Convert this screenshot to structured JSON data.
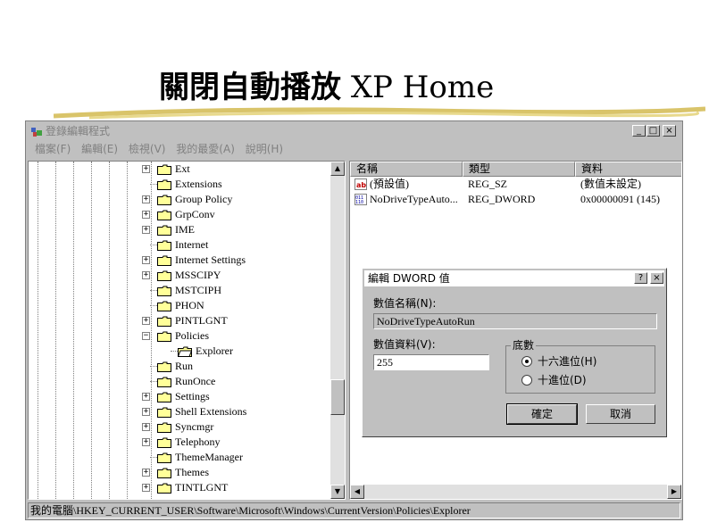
{
  "slide": {
    "title_cjk": "關閉自動播放",
    "title_latin": "XP Home"
  },
  "window": {
    "title": "登錄編輯程式",
    "buttons": {
      "minimize": "_",
      "maximize": "□",
      "close": "×"
    },
    "menu": [
      "檔案(F)",
      "編輯(E)",
      "檢視(V)",
      "我的最愛(A)",
      "說明(H)"
    ]
  },
  "tree": {
    "items": [
      {
        "label": "Ext",
        "expander": "+"
      },
      {
        "label": "Extensions",
        "expander": ""
      },
      {
        "label": "Group Policy",
        "expander": "+"
      },
      {
        "label": "GrpConv",
        "expander": "+"
      },
      {
        "label": "IME",
        "expander": "+"
      },
      {
        "label": "Internet",
        "expander": ""
      },
      {
        "label": "Internet Settings",
        "expander": "+"
      },
      {
        "label": "MSSCIPY",
        "expander": "+"
      },
      {
        "label": "MSTCIPH",
        "expander": ""
      },
      {
        "label": "PHON",
        "expander": ""
      },
      {
        "label": "PINTLGNT",
        "expander": "+"
      },
      {
        "label": "Policies",
        "expander": "−"
      },
      {
        "label": "Explorer",
        "expander": "",
        "child": true
      },
      {
        "label": "Run",
        "expander": ""
      },
      {
        "label": "RunOnce",
        "expander": ""
      },
      {
        "label": "Settings",
        "expander": "+"
      },
      {
        "label": "Shell Extensions",
        "expander": "+"
      },
      {
        "label": "Syncmgr",
        "expander": "+"
      },
      {
        "label": "Telephony",
        "expander": "+"
      },
      {
        "label": "ThemeManager",
        "expander": ""
      },
      {
        "label": "Themes",
        "expander": "+"
      },
      {
        "label": "TINTLGNT",
        "expander": "+"
      }
    ]
  },
  "list": {
    "headers": {
      "name": "名稱",
      "type": "類型",
      "data": "資料"
    },
    "rows": [
      {
        "name": "(預設值)",
        "type": "REG_SZ",
        "data": "(數值未設定)",
        "icon": "string-value-icon"
      },
      {
        "name": "NoDriveTypeAuto...",
        "type": "REG_DWORD",
        "data": "0x00000091 (145)",
        "icon": "binary-value-icon"
      }
    ]
  },
  "status": "我的電腦\\HKEY_CURRENT_USER\\Software\\Microsoft\\Windows\\CurrentVersion\\Policies\\Explorer",
  "dialog": {
    "title": "編輯 DWORD 值",
    "help": "?",
    "close": "×",
    "name_label": "數值名稱(N):",
    "name_value": "NoDriveTypeAutoRun",
    "data_label": "數值資料(V):",
    "data_value": "255",
    "base_label": "底數",
    "base_options": [
      {
        "label": "十六進位(H)",
        "selected": true
      },
      {
        "label": "十進位(D)",
        "selected": false
      }
    ],
    "ok": "確定",
    "cancel": "取消"
  },
  "colors": {
    "win_face": "#c0c0c0",
    "window_bg": "#ffffff",
    "folder": "#ffff99"
  }
}
